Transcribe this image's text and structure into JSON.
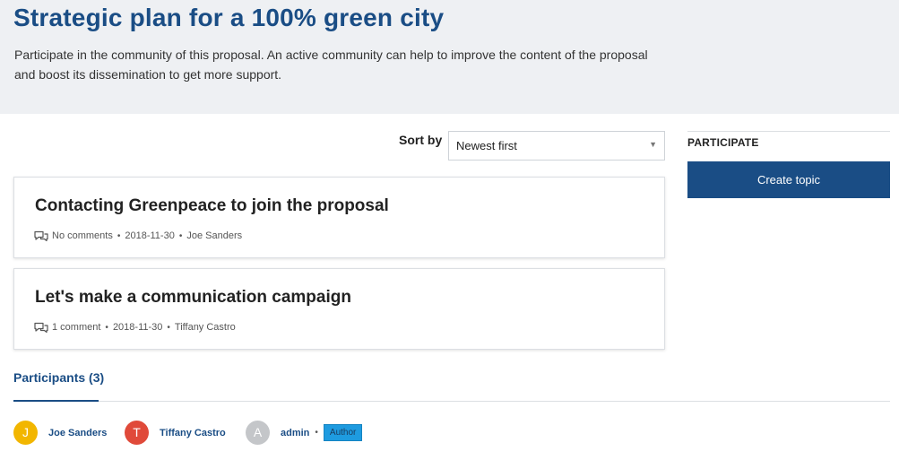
{
  "header": {
    "title": "Strategic plan for a 100% green city",
    "description": "Participate in the community of this proposal. An active community can help to improve the content of the proposal and boost its dissemination to get more support."
  },
  "sort": {
    "label": "Sort by",
    "selected": "Newest first"
  },
  "topics": [
    {
      "title": "Contacting Greenpeace to join the proposal",
      "comments": "No comments",
      "date": "2018-11-30",
      "author": "Joe Sanders"
    },
    {
      "title": "Let's make a communication campaign",
      "comments": "1 comment",
      "date": "2018-11-30",
      "author": "Tiffany Castro"
    }
  ],
  "sidebar": {
    "title": "PARTICIPATE",
    "create_label": "Create topic"
  },
  "participants": {
    "tab_label": "Participants (3)",
    "list": [
      {
        "initial": "J",
        "name": "Joe Sanders",
        "color": "#f2b600"
      },
      {
        "initial": "T",
        "name": "Tiffany Castro",
        "color": "#e04a3a"
      },
      {
        "initial": "A",
        "name": "admin",
        "color": "#c4c6c9",
        "badge": "Author"
      }
    ]
  },
  "colors": {
    "brand": "#1a4d85",
    "badge": "#1e9be0",
    "header_bg": "#eef0f3"
  },
  "icons": {
    "comment": "comment-icon",
    "dropdown": "chevron-down-icon"
  }
}
